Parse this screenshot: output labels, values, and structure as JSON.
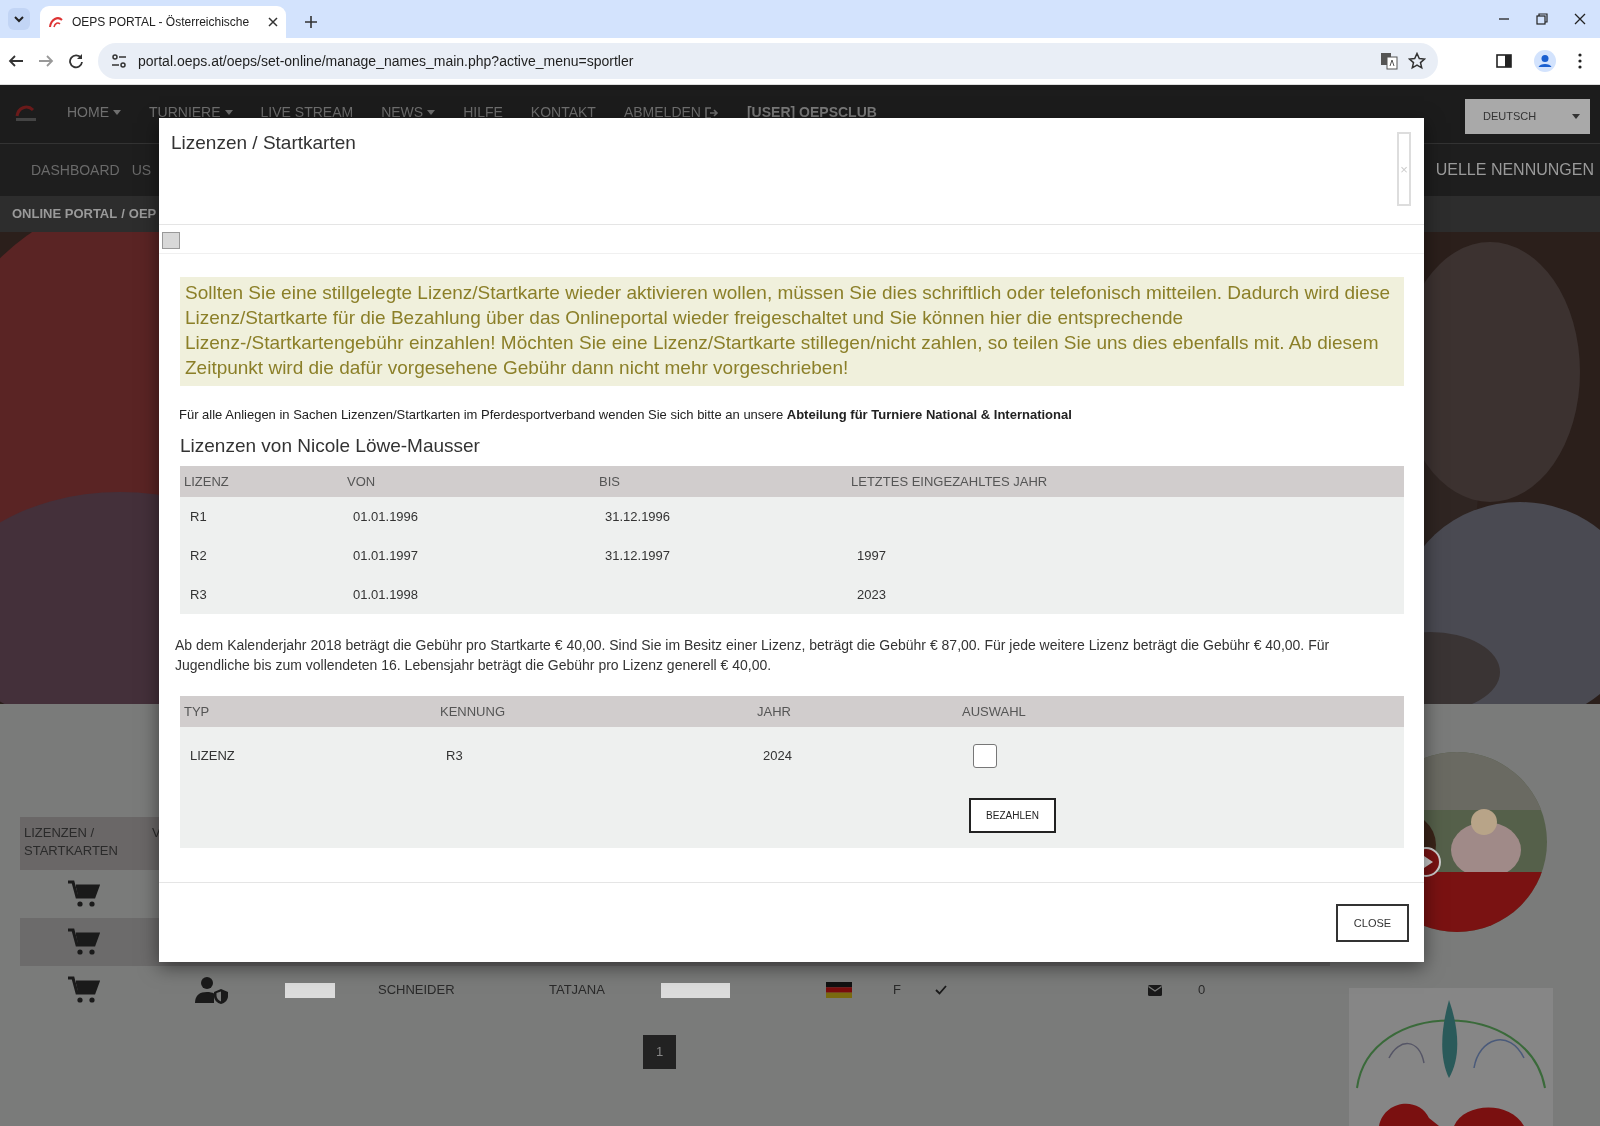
{
  "browser": {
    "tab_title": "OEPS PORTAL - Österreichische",
    "url": "portal.oeps.at/oeps/set-online/manage_names_main.php?active_menu=sportler"
  },
  "navbar": {
    "items": [
      {
        "label": "HOME",
        "kind": "dropdown"
      },
      {
        "label": "TURNIERE",
        "kind": "dropdown"
      },
      {
        "label": "LIVE STREAM",
        "kind": "link"
      },
      {
        "label": "NEWS",
        "kind": "dropdown"
      },
      {
        "label": "HILFE",
        "kind": "link"
      },
      {
        "label": "KONTAKT",
        "kind": "link"
      },
      {
        "label": "ABMELDEN",
        "kind": "logout"
      },
      {
        "label": "[USER] OEPSCLUB",
        "kind": "user"
      }
    ],
    "language": "DEUTSCH"
  },
  "subnav": {
    "items": [
      "DASHBOARD",
      "US"
    ],
    "right_item": "UELLE NENNUNGEN"
  },
  "breadcrumb": {
    "items": [
      "ONLINE PORTAL",
      "OEP"
    ],
    "separator": "/"
  },
  "athletes": {
    "columns": [
      "LIZENZEN / STARTKARTEN",
      "V"
    ],
    "rows": [
      {
        "striped": false
      },
      {
        "striped": true
      },
      {
        "striped": false,
        "last_name": "SCHNEIDER",
        "first_name": "TATJANA",
        "gender": "F",
        "verified": true,
        "messages": "0"
      }
    ]
  },
  "pagination": [
    {
      "label": "1",
      "selected": true
    }
  ],
  "modal": {
    "title": "Lizenzen / Startkarten",
    "close_symbol": "×",
    "notice": "Sollten Sie eine stillgelegte Lizenz/Startkarte wieder aktivieren wollen, müssen Sie dies schriftlich oder telefonisch mitteilen. Dadurch wird diese Lizenz/Startkarte für die Bezahlung über das Onlineportal wieder freigeschaltet und Sie können hier die entsprechende Lizenz-/Startkartengebühr einzahlen! Möchten Sie eine Lizenz/Startkarte stillegen/nicht zahlen, so teilen Sie uns dies ebenfalls mit. Ab diesem Zeitpunkt wird die dafür vorgesehene Gebühr dann nicht mehr vorgeschrieben!",
    "contact": {
      "text": "Für alle Anliegen in Sachen Lizenzen/Startkarten im Pferdesportverband wenden Sie sich bitte an unsere",
      "link": "Abteilung für Turniere National & International"
    },
    "heading": "Lizenzen von Nicole Löwe-Mausser",
    "licenses": {
      "columns": [
        "LIZENZ",
        "VON",
        "BIS",
        "LETZTES EINGEZAHLTES JAHR"
      ],
      "rows": [
        {
          "lizenz": "R1",
          "von": "01.01.1996",
          "bis": "31.12.1996"
        },
        {
          "lizenz": "R2",
          "von": "01.01.1997",
          "bis": "31.12.1997",
          "letztes_jahr": "1997"
        },
        {
          "lizenz": "R3",
          "von": "01.01.1998",
          "letztes_jahr": "2023"
        }
      ]
    },
    "fee_info": "Ab dem Kalenderjahr 2018 beträgt die Gebühr pro Startkarte € 40,00. Sind Sie im Besitz einer Lizenz, beträgt die Gebühr € 87,00. Für jede weitere Lizenz beträgt die Gebühr € 40,00. Für Jugendliche bis zum vollendeten 16. Lebensjahr beträgt die Gebühr pro Lizenz generell € 40,00.",
    "payments": {
      "columns": [
        "TYP",
        "KENNUNG",
        "JAHR",
        "AUSWAHL"
      ],
      "rows": [
        {
          "typ": "LIZENZ",
          "kennung": "R3",
          "jahr": "2024",
          "checked": false
        }
      ],
      "pay_button": "BEZAHLEN"
    },
    "close_button": "CLOSE"
  }
}
